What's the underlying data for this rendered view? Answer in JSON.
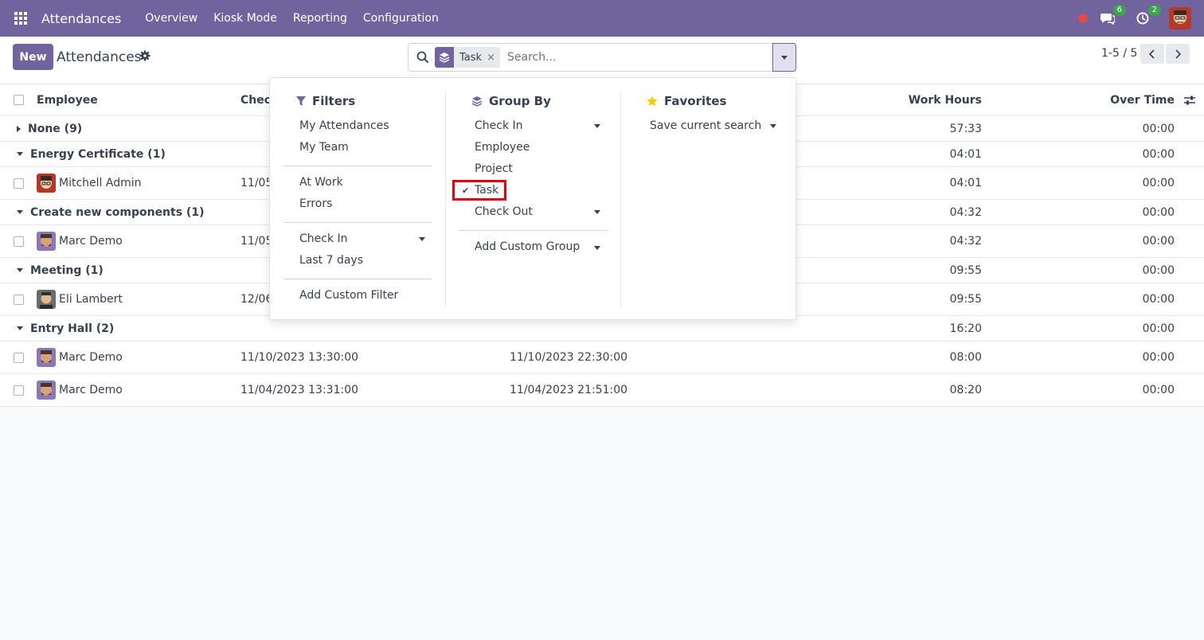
{
  "navbar": {
    "app_title": "Attendances",
    "menu": [
      "Overview",
      "Kiosk Mode",
      "Reporting",
      "Configuration"
    ],
    "messages_count": "6",
    "activities_count": "2"
  },
  "control": {
    "new_label": "New",
    "title": "Attendances",
    "facet_label": "Task",
    "facet_remove": "×",
    "search_placeholder": "Search...",
    "pager": "1-5 / 5"
  },
  "list": {
    "headers": {
      "employee": "Employee",
      "check_in": "Check",
      "work_hours": "Work Hours",
      "over_time": "Over Time"
    },
    "groups": [
      {
        "name": "None (9)",
        "work_hours": "57:33",
        "over_time": "00:00",
        "open": false
      },
      {
        "name": "Energy Certificate (1)",
        "work_hours": "04:01",
        "over_time": "00:00",
        "open": true
      },
      {
        "name": "Create new components (1)",
        "work_hours": "04:32",
        "over_time": "00:00",
        "open": true
      },
      {
        "name": "Meeting (1)",
        "work_hours": "09:55",
        "over_time": "00:00",
        "open": true
      },
      {
        "name": "Entry Hall (2)",
        "work_hours": "16:20",
        "over_time": "00:00",
        "open": true
      }
    ],
    "records": [
      {
        "employee": "Mitchell Admin",
        "check_in": "11/05",
        "check_out": "",
        "work_hours": "04:01",
        "over_time": "00:00"
      },
      {
        "employee": "Marc Demo",
        "check_in": "11/05",
        "check_out": "",
        "work_hours": "04:32",
        "over_time": "00:00"
      },
      {
        "employee": "Eli Lambert",
        "check_in": "12/06",
        "check_out": "",
        "work_hours": "09:55",
        "over_time": "00:00"
      },
      {
        "employee": "Marc Demo",
        "check_in": "11/10/2023 13:30:00",
        "check_out": "11/10/2023 22:30:00",
        "work_hours": "08:00",
        "over_time": "00:00"
      },
      {
        "employee": "Marc Demo",
        "check_in": "11/04/2023 13:31:00",
        "check_out": "11/04/2023 21:51:00",
        "work_hours": "08:20",
        "over_time": "00:00"
      }
    ]
  },
  "dropdown": {
    "filters": {
      "title": "Filters",
      "items": [
        "My Attendances",
        "My Team",
        "At Work",
        "Errors",
        "Check In",
        "Last 7 days",
        "Add Custom Filter"
      ]
    },
    "group_by": {
      "title": "Group By",
      "items": [
        "Check In",
        "Employee",
        "Project",
        "Task",
        "Check Out",
        "Add Custom Group"
      ],
      "checkmark": "✔"
    },
    "favorites": {
      "title": "Favorites",
      "items": [
        "Save current search"
      ]
    }
  },
  "colors": {
    "brand": "#71639e",
    "highlight": "#e0000f",
    "badge": "#3fa34d",
    "star": "#f3cc00"
  }
}
